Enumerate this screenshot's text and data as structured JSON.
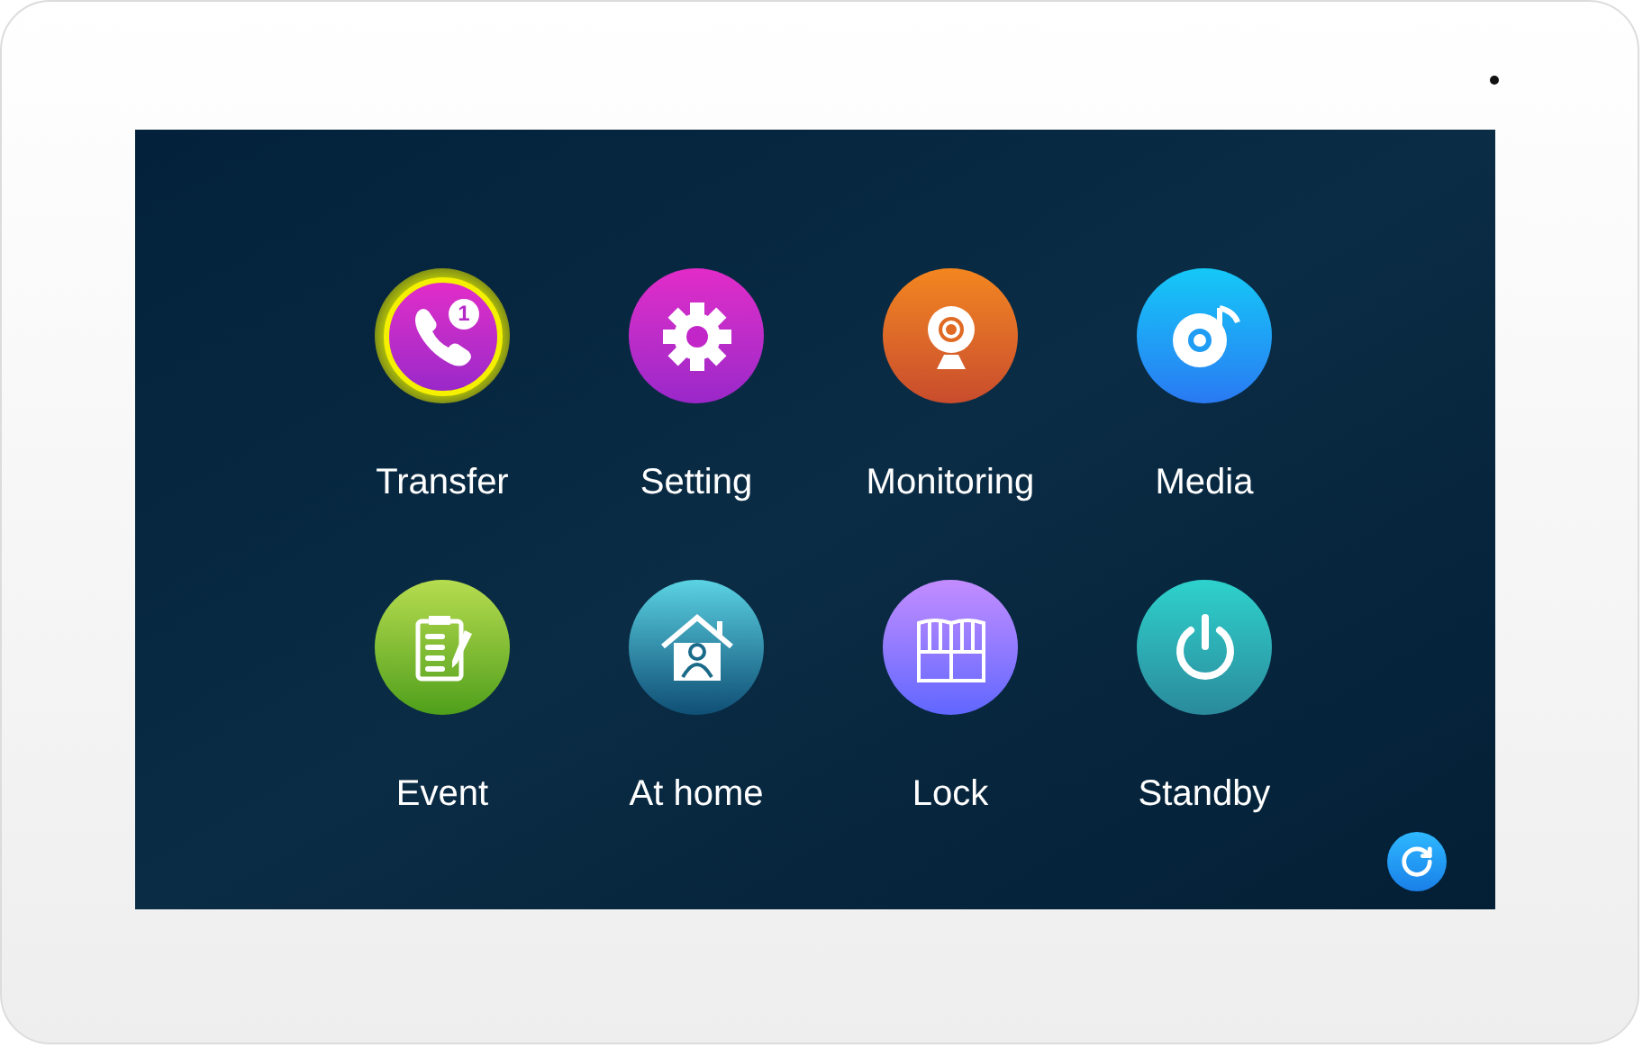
{
  "menu": [
    {
      "label": "Transfer",
      "kind": "transfer",
      "selected": true,
      "badge": "1"
    },
    {
      "label": "Setting",
      "kind": "setting",
      "selected": false
    },
    {
      "label": "Monitoring",
      "kind": "monitoring",
      "selected": false
    },
    {
      "label": "Media",
      "kind": "media",
      "selected": false
    },
    {
      "label": "Event",
      "kind": "event",
      "selected": false
    },
    {
      "label": "At home",
      "kind": "athome",
      "selected": false
    },
    {
      "label": "Lock",
      "kind": "lock",
      "selected": false
    },
    {
      "label": "Standby",
      "kind": "standby",
      "selected": false
    }
  ]
}
